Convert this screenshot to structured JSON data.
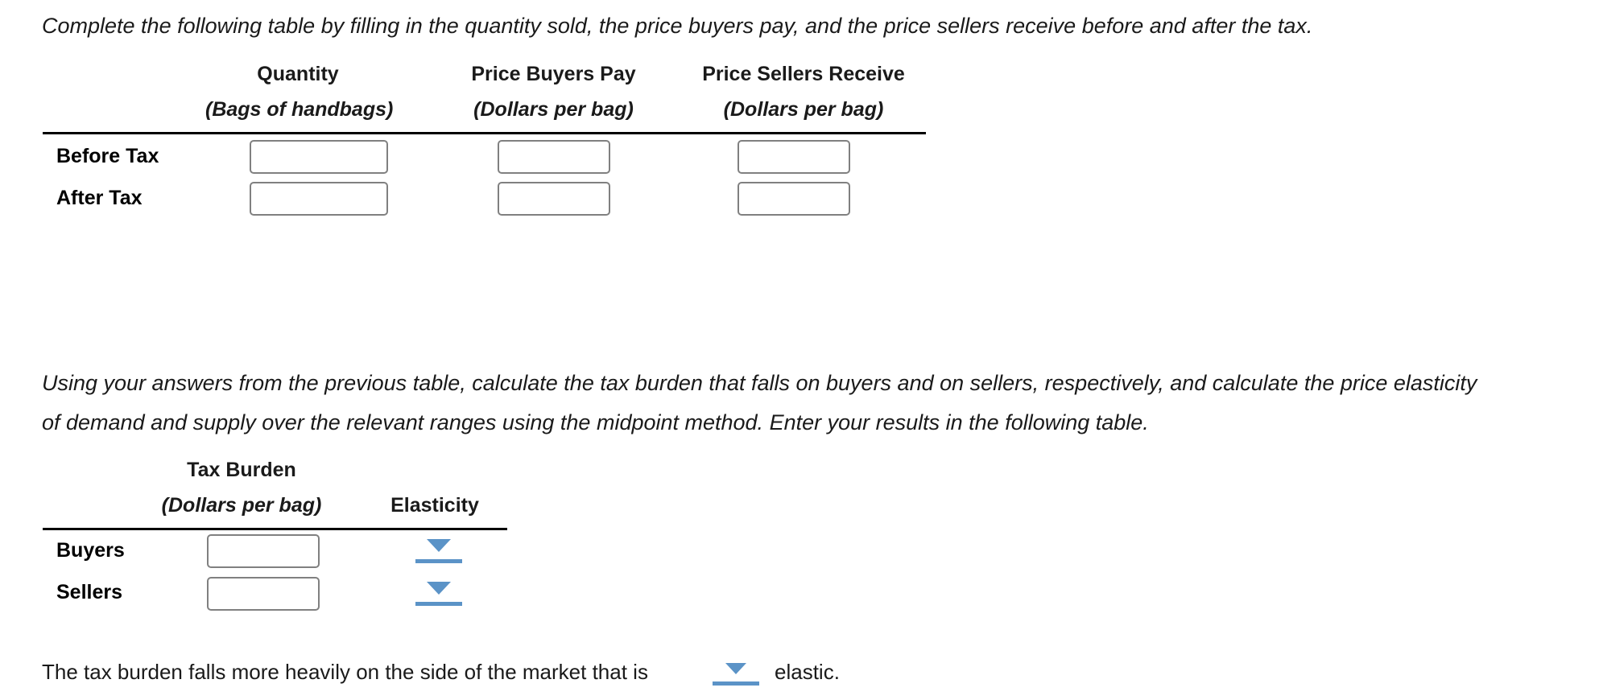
{
  "intro": {
    "text": "Complete the following table by filling in the quantity sold, the price buyers pay, and the price sellers receive before and after the tax."
  },
  "table1": {
    "headers": [
      {
        "title": "Quantity",
        "unit": "(Bags of handbags)"
      },
      {
        "title": "Price Buyers Pay",
        "unit": "(Dollars per bag)"
      },
      {
        "title": "Price Sellers Receive",
        "unit": "(Dollars per bag)"
      }
    ],
    "rows": [
      {
        "label": "Before Tax",
        "quantity": "",
        "price_buyers_pay": "",
        "price_sellers_receive": ""
      },
      {
        "label": "After Tax",
        "quantity": "",
        "price_buyers_pay": "",
        "price_sellers_receive": ""
      }
    ]
  },
  "second_prompt": {
    "line1": "Using your answers from the previous table, calculate the tax burden that falls on buyers and on sellers, respectively, and calculate the price elasticity",
    "line2": "of demand and supply over the relevant ranges using the midpoint method. Enter your results in the following table."
  },
  "table2": {
    "headers": [
      {
        "title": "Tax Burden",
        "unit": "(Dollars per bag)"
      },
      {
        "title": "Elasticity",
        "unit": ""
      }
    ],
    "rows": [
      {
        "label": "Buyers",
        "tax_burden": "",
        "elasticity_selected": ""
      },
      {
        "label": "Sellers",
        "tax_burden": "",
        "elasticity_selected": ""
      }
    ]
  },
  "conclusion": {
    "before_dropdown": "The tax burden falls more heavily on the side of the market that is",
    "dropdown_selected": "",
    "after_dropdown": "elastic."
  },
  "colors": {
    "dropdown_blue": "#5b93c7",
    "input_border": "#808080",
    "rule": "#000000",
    "text": "#1a1a1a"
  }
}
